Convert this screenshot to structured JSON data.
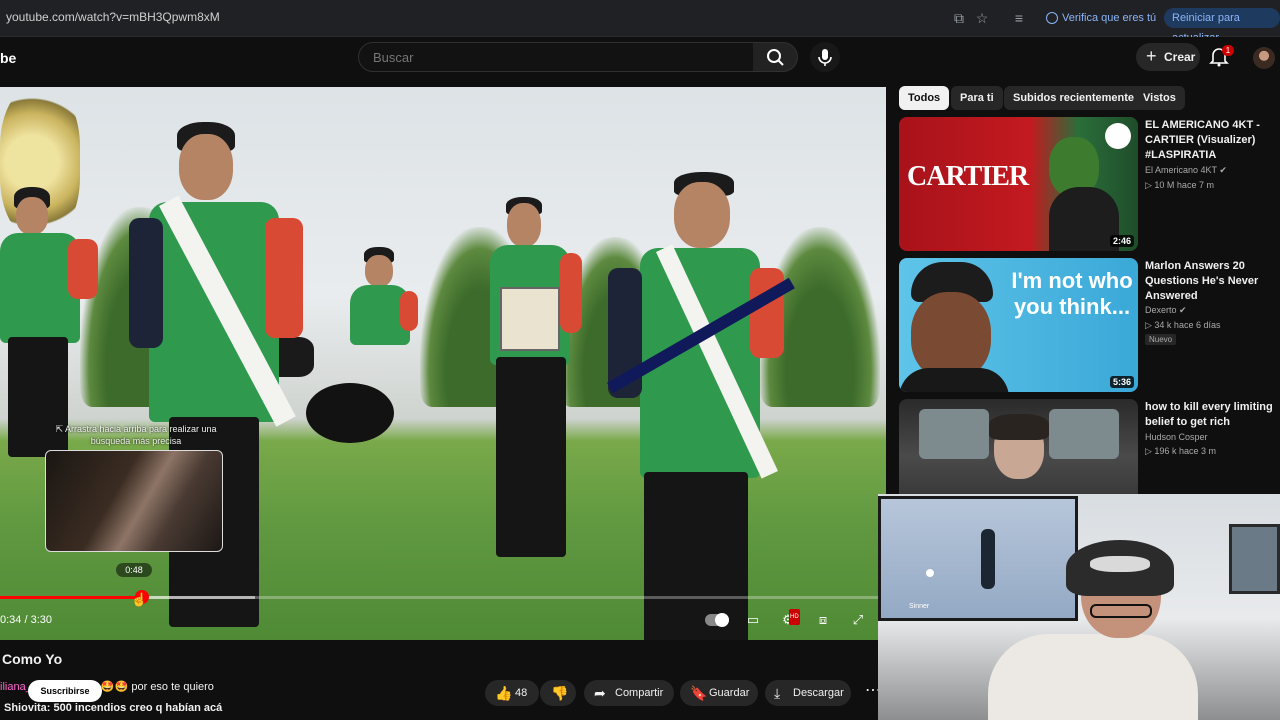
{
  "browser": {
    "url": "youtube.com/watch?v=mBH3Qpwm8xM",
    "verify_label": "Verifica que eres tú",
    "restart_label": "Reiniciar para actualizar"
  },
  "header": {
    "logo_text": "be",
    "search_placeholder": "Buscar",
    "create_label": "Crear",
    "notification_count": "1"
  },
  "player": {
    "hint": "⇱ Arrastra hacia arriba para realizar una búsqueda más precisa",
    "preview_time": "0:48",
    "time": "0:34 / 3:30",
    "progress": 0.162,
    "buffered": 0.29
  },
  "video": {
    "title": "Como Yo",
    "like_count": "48",
    "share_label": "Compartir",
    "save_label": "Guardar",
    "download_label": "Descargar",
    "subscribe_label": "Suscribirse"
  },
  "chat": {
    "line1_user": "iliana_0003",
    "line1_text": ": gracias 🤩🤩 por eso te quiero",
    "line2": "Shiovita: 500 incendios creo q habían acá"
  },
  "sidebar": {
    "chips": [
      "Todos",
      "Para ti",
      "Subidos recientemente",
      "Vistos"
    ],
    "videos": [
      {
        "title": "EL AMERICANO 4KT - CARTIER (Visualizer) #LASPIRATIA",
        "channel": "El Americano 4KT",
        "verified": true,
        "meta": "10 M  hace 7 m",
        "duration": "2:46",
        "thumb_text": "CARTIER",
        "badge": ""
      },
      {
        "title": "Marlon Answers 20 Questions He's Never Answered",
        "channel": "Dexerto",
        "verified": true,
        "meta": "34 k  hace 6 días",
        "duration": "5:36",
        "thumb_text": "I'm not who you think...",
        "badge": "Nuevo"
      },
      {
        "title": "how to kill every limiting belief to get rich",
        "channel": "Hudson Cosper",
        "verified": false,
        "meta": "196 k  hace 3 m",
        "duration": "",
        "thumb_text": "",
        "badge": ""
      }
    ]
  },
  "webcam": {
    "tv_text": "Sinner"
  },
  "colors": {
    "accent": "#ff0000",
    "background": "#0f0f0f",
    "chip_bg": "#272727"
  }
}
